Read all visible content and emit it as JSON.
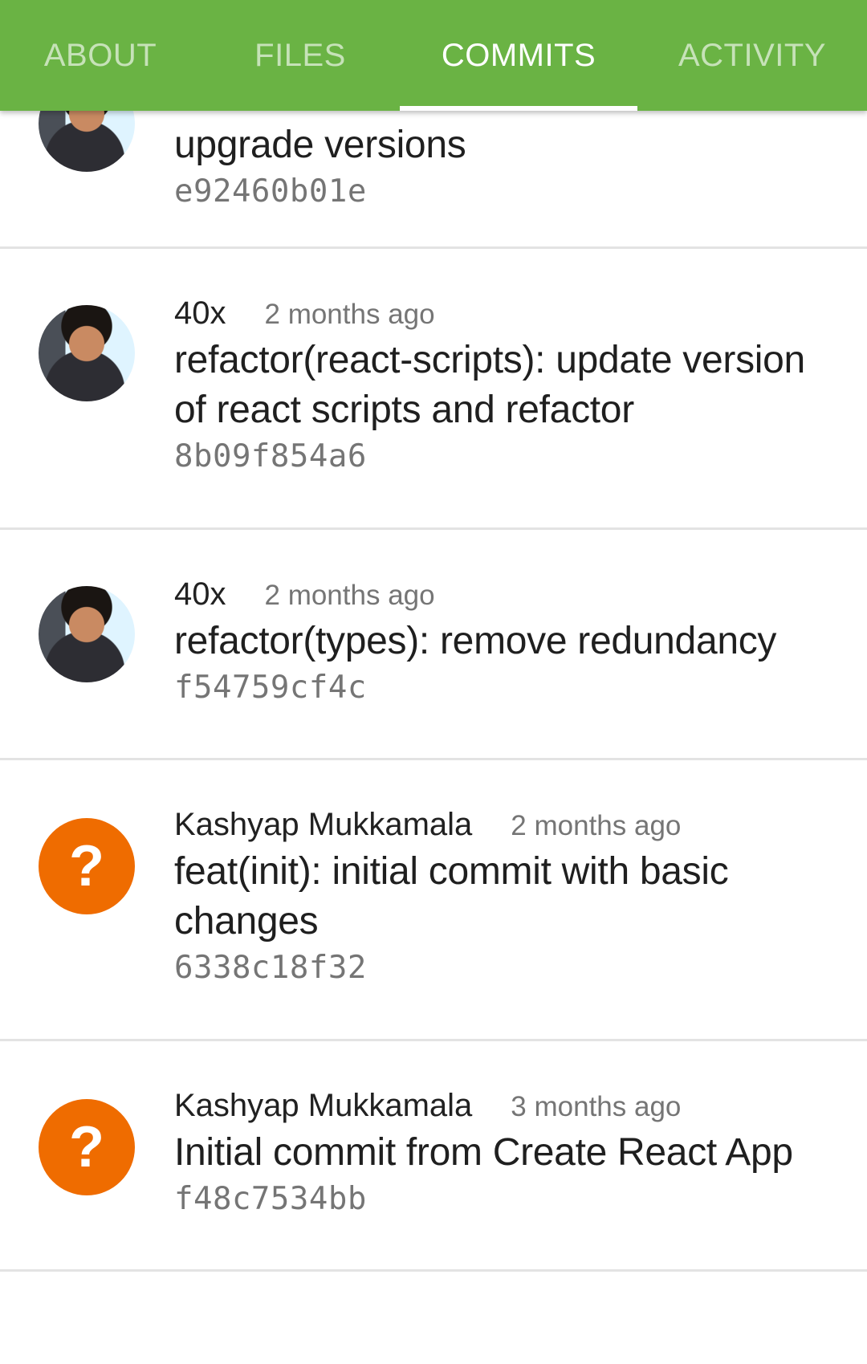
{
  "tabs": [
    {
      "label": "ABOUT",
      "active": false
    },
    {
      "label": "FILES",
      "active": false
    },
    {
      "label": "COMMITS",
      "active": true
    },
    {
      "label": "ACTIVITY",
      "active": false
    }
  ],
  "commits": [
    {
      "author": "",
      "time": "",
      "message": "upgrade versions",
      "sha": "e92460b01e",
      "avatar": "user-photo-icon"
    },
    {
      "author": "40x",
      "time": "2 months ago",
      "message": "refactor(react-scripts): update version of react scripts and refactor",
      "sha": "8b09f854a6",
      "avatar": "user-photo-icon"
    },
    {
      "author": "40x",
      "time": "2 months ago",
      "message": "refactor(types): remove redundancy",
      "sha": "f54759cf4c",
      "avatar": "user-photo-icon"
    },
    {
      "author": "Kashyap Mukkamala",
      "time": "2 months ago",
      "message": "feat(init): initial commit with basic changes",
      "sha": "6338c18f32",
      "avatar": "unknown-user-icon",
      "avatar_glyph": "?"
    },
    {
      "author": "Kashyap Mukkamala",
      "time": "3 months ago",
      "message": "Initial commit from Create React App",
      "sha": "f48c7534bb",
      "avatar": "unknown-user-icon",
      "avatar_glyph": "?"
    }
  ],
  "colors": {
    "toolbar": "#6ab344",
    "unknown_avatar": "#ef6c00"
  }
}
